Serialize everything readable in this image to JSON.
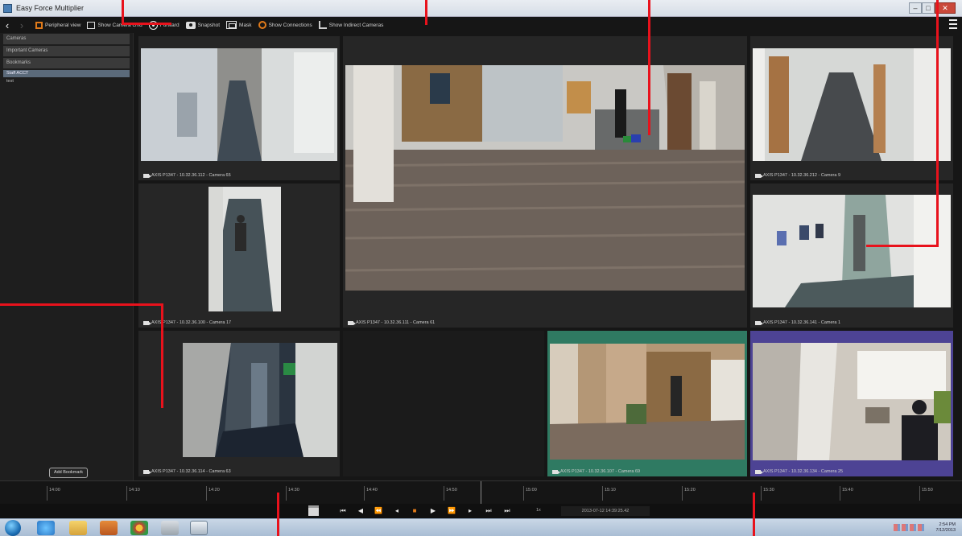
{
  "window": {
    "title": "Easy Force Multiplier"
  },
  "toolbar": {
    "back_glyph": "‹",
    "forward_glyph": "›",
    "items": [
      {
        "label": "Peripheral view",
        "icon": "peripheral-view-icon"
      },
      {
        "label": "Show Camera Grid",
        "icon": "camera-grid-icon"
      },
      {
        "label": "Forward",
        "icon": "forward-radio-icon"
      },
      {
        "label": "Snapshot",
        "icon": "snapshot-camera-icon"
      },
      {
        "label": "Mask",
        "icon": "mask-icon"
      },
      {
        "label": "Show Connections",
        "icon": "connections-icon"
      },
      {
        "label": "Show Indirect Cameras",
        "icon": "indirect-cameras-icon"
      }
    ]
  },
  "sidebar": {
    "sections": [
      "Cameras",
      "Important Cameras",
      "Bookmarks"
    ],
    "bookmarks": [
      "Staff ACCT",
      "test"
    ],
    "add_bookmark_label": "Add Bookmark"
  },
  "tiles": [
    {
      "caption": "AXIS P1347 - 10.32.36.112 - Camera 65",
      "style": "normal"
    },
    {
      "caption": "AXIS P1347 - 10.32.36.111 - Camera 61",
      "style": "normal"
    },
    {
      "caption": "AXIS P1347 - 10.32.36.212 - Camera 9",
      "style": "normal"
    },
    {
      "caption": "AXIS P1347 - 10.32.36.100 - Camera 17",
      "style": "normal"
    },
    {
      "caption": "AXIS P1347 - 10.32.36.141 - Camera 1",
      "style": "normal"
    },
    {
      "caption": "AXIS P1347 - 10.32.36.114 - Camera 63",
      "style": "normal"
    },
    {
      "caption": "AXIS P1347 - 10.32.36.107 - Camera 69",
      "style": "green"
    },
    {
      "caption": "AXIS P1347 - 10.32.36.134 - Camera 25",
      "style": "purple"
    }
  ],
  "timeline": {
    "ticks": [
      "14:00",
      "14:10",
      "14:20",
      "14:30",
      "14:40",
      "14:50",
      "15:00",
      "15:10",
      "15:20",
      "15:30",
      "15:40",
      "15:50"
    ]
  },
  "transport": {
    "buttons": [
      {
        "glyph": "⏮",
        "name": "skip-start-button"
      },
      {
        "glyph": "◀",
        "name": "step-back-button"
      },
      {
        "glyph": "⏪",
        "name": "rewind-fast-button"
      },
      {
        "glyph": "◂",
        "name": "rewind-button"
      },
      {
        "glyph": "■",
        "name": "stop-button"
      },
      {
        "glyph": "▶",
        "name": "play-button"
      },
      {
        "glyph": "⏩",
        "name": "fast-forward-button"
      },
      {
        "glyph": "▸",
        "name": "step-forward-button"
      },
      {
        "glyph": "⏭",
        "name": "skip-next-button"
      },
      {
        "glyph": "⏭",
        "name": "skip-end-button"
      }
    ],
    "speed": "1x",
    "datetime": "2013-07-12 14:39:25.42"
  },
  "taskbar": {
    "clock_time": "2:54 PM",
    "clock_date": "7/12/2013"
  },
  "colors": {
    "accent_orange": "#e07a1a",
    "selected_green": "#2f7a62",
    "selected_purple": "#4d4394",
    "annotation_red": "#e8121c"
  }
}
